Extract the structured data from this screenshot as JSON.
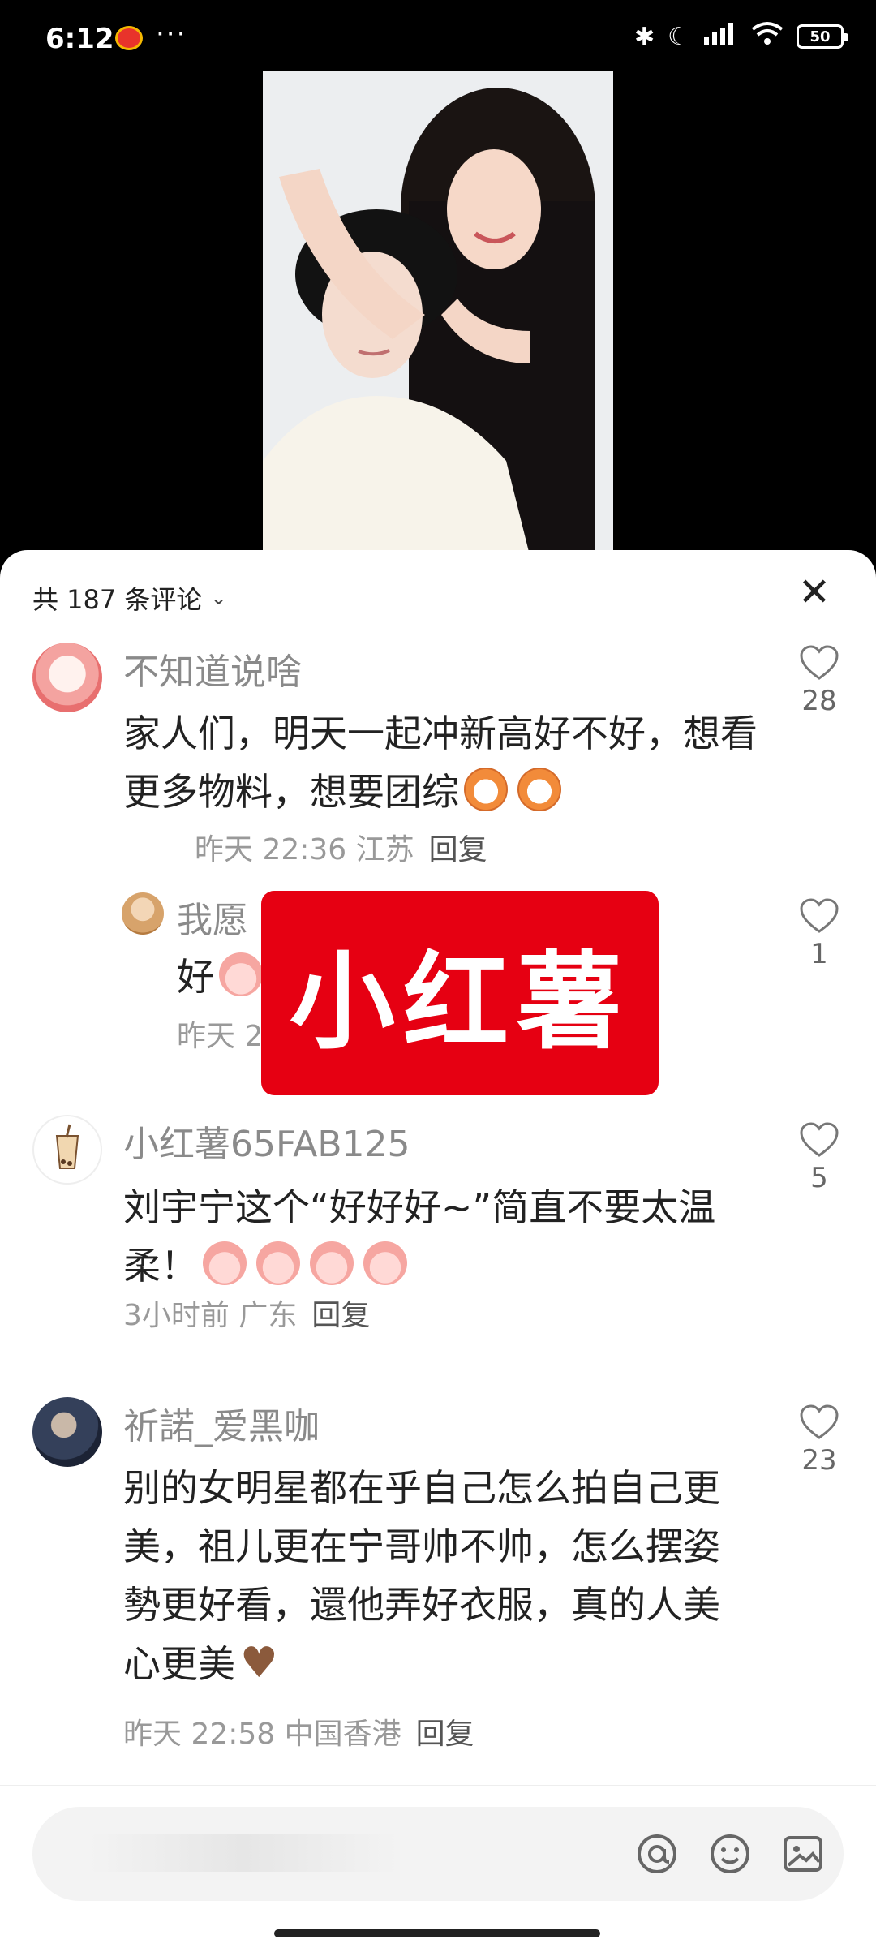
{
  "status_bar": {
    "time": "6:12",
    "more": "···",
    "battery": "50"
  },
  "sheet": {
    "title": "共 187 条评论",
    "chevron": "⌄",
    "close": "✕"
  },
  "comments": [
    {
      "user": "不知道说啥",
      "text": "家人们，明天一起冲新高好不好，想看更多物料，想要团综",
      "meta": "昨天 22:36 江苏",
      "reply": "回复",
      "likes": "28"
    },
    {
      "user": "我愿",
      "text": "好",
      "meta": "昨天 2",
      "reply": "",
      "likes": "1"
    },
    {
      "user": "小红薯65FAB125",
      "text": "刘宇宁这个“好好好~”简直不要太温柔！",
      "meta": "3小时前 广东",
      "reply": "回复",
      "likes": "5"
    },
    {
      "user": "祈諾_爱黑咖",
      "text": "别的女明星都在乎自己怎么拍自己更美，祖儿更在宁哥帅不帅，怎么摆姿勢更好看，還他弄好衣服，真的人美心更美",
      "meta": "昨天 22:58 中国香港",
      "reply": "回复",
      "likes": "23"
    }
  ],
  "watermark": "小红薯",
  "colors": {
    "brand_red": "#e60012",
    "like_outline": "#777777"
  }
}
